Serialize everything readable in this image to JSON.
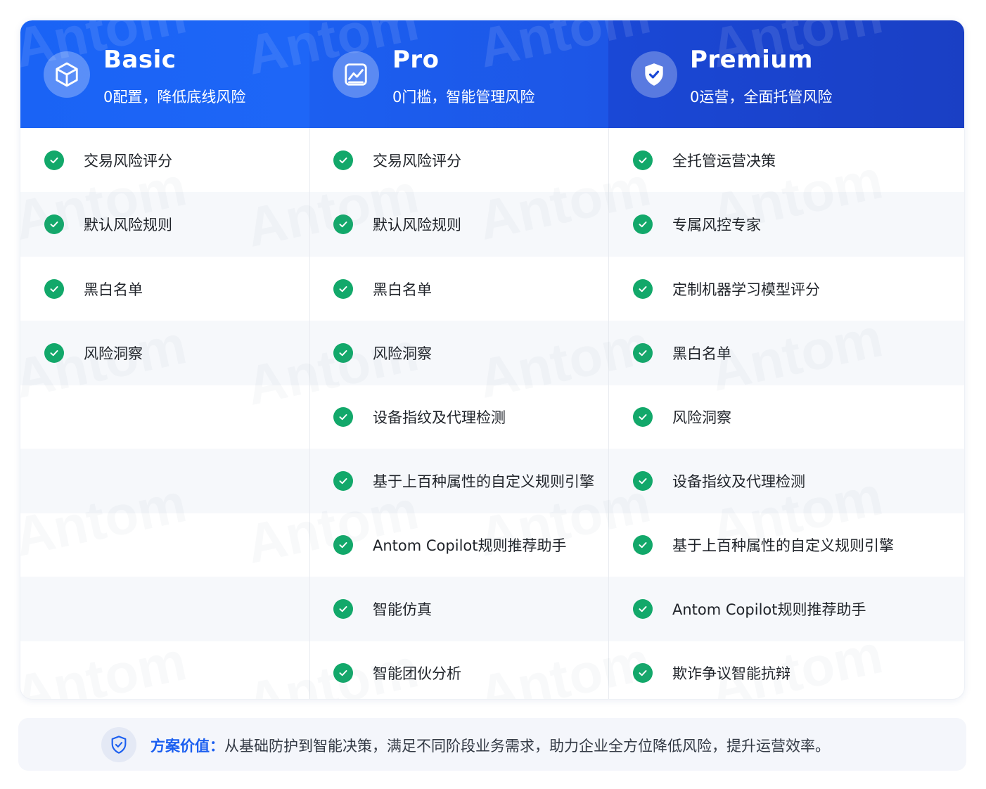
{
  "plans": [
    {
      "name": "Basic",
      "subtitle": "0配置，降低底线风险",
      "icon": "cube-icon",
      "features": [
        "交易风险评分",
        "默认风险规则",
        "黑白名单",
        "风险洞察"
      ]
    },
    {
      "name": "Pro",
      "subtitle": "0门槛，智能管理风险",
      "icon": "chart-icon",
      "features": [
        "交易风险评分",
        "默认风险规则",
        "黑白名单",
        "风险洞察",
        "设备指纹及代理检测",
        "基于上百种属性的自定义规则引擎",
        "Antom Copilot规则推荐助手",
        "智能仿真",
        "智能团伙分析"
      ]
    },
    {
      "name": "Premium",
      "subtitle": "0运营，全面托管风险",
      "icon": "shield-icon",
      "features": [
        "全托管运营决策",
        "专属风控专家",
        "定制机器学习模型评分",
        "黑白名单",
        "风险洞察",
        "设备指纹及代理检测",
        "基于上百种属性的自定义规则引擎",
        "Antom Copilot规则推荐助手",
        "欺诈争议智能抗辩"
      ]
    }
  ],
  "footer": {
    "label": "方案价值：",
    "text": "从基础防护到智能决策，满足不同阶段业务需求，助力企业全方位降低风险，提升运营效率。",
    "icon": "shield-check-icon"
  },
  "watermark": "Antom",
  "colors": {
    "accent": "#1a5ef0",
    "check": "#12a86a",
    "basic_header": "#1e66f7",
    "pro_header": "#1d56e6",
    "premium_header": "#1a3fc4"
  }
}
